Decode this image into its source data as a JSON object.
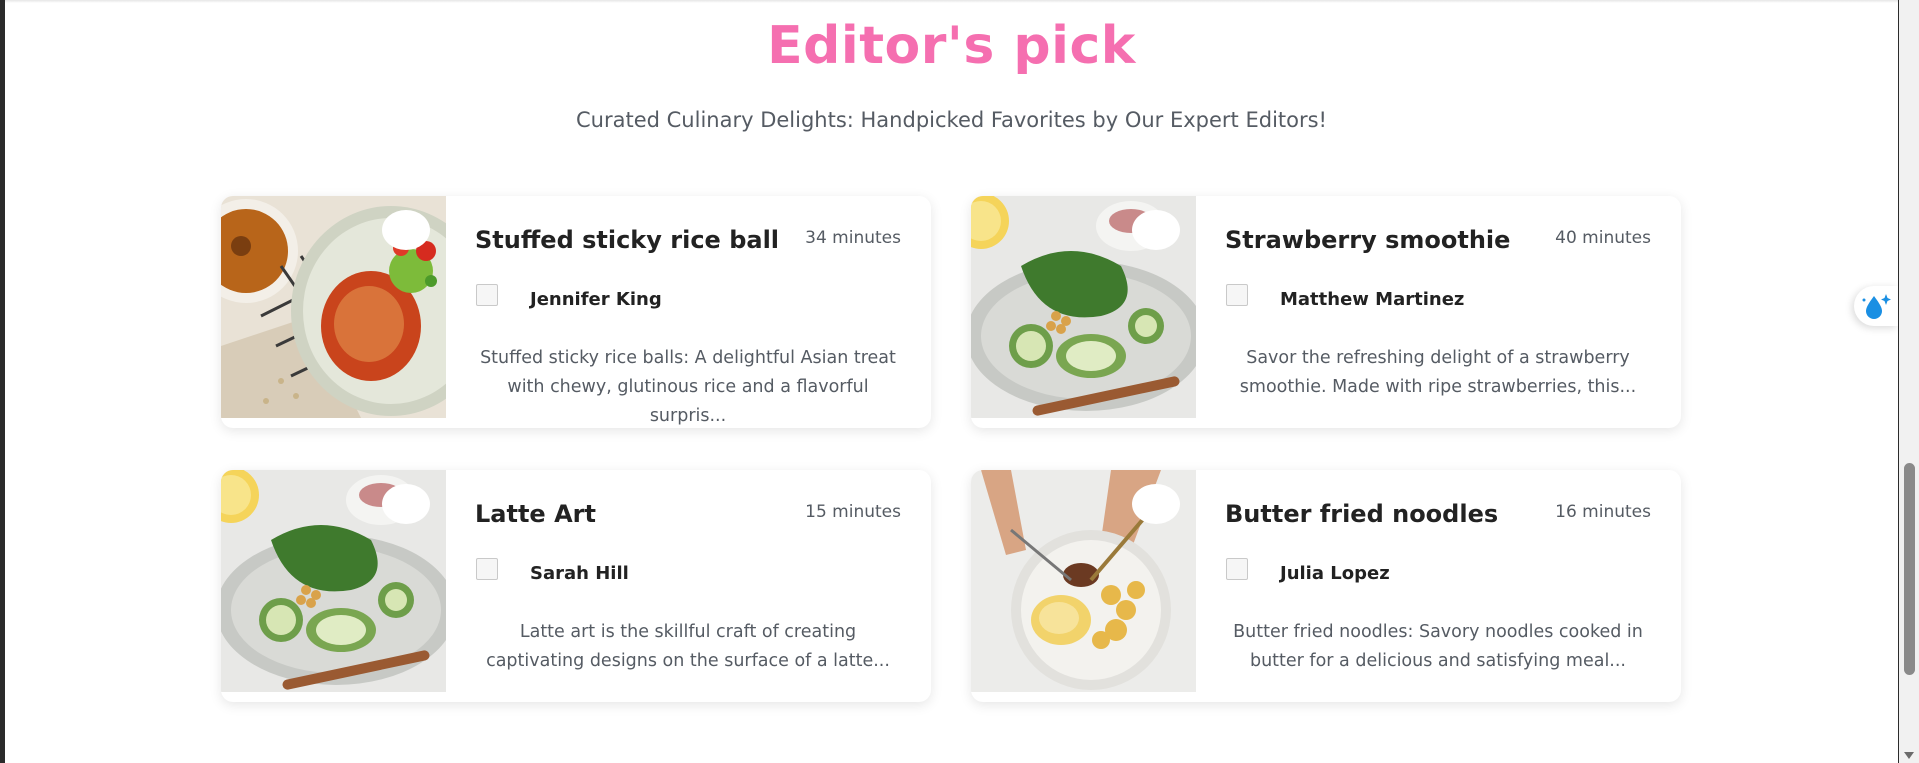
{
  "section": {
    "title": "Editor's pick",
    "subtitle": "Curated Culinary Delights: Handpicked Favorites by Our Expert Editors!"
  },
  "recipes": [
    {
      "title": "Stuffed sticky rice ball",
      "duration": "34 minutes",
      "author": "Jennifer King",
      "description": "Stuffed sticky rice balls: A delightful Asian treat with chewy, glutinous rice and a flavorful surpris...",
      "image": "food-photo-sauce-dish"
    },
    {
      "title": "Strawberry smoothie",
      "duration": "40 minutes",
      "author": "Matthew Martinez",
      "description": "Savor the refreshing delight of a strawberry smoothie. Made with ripe strawberries, this...",
      "image": "food-photo-zucchini-plate"
    },
    {
      "title": "Latte Art",
      "duration": "15 minutes",
      "author": "Sarah Hill",
      "description": "Latte art is the skillful craft of creating captivating designs on the surface of a latte...",
      "image": "food-photo-zucchini-plate"
    },
    {
      "title": "Butter fried noodles",
      "duration": "16 minutes",
      "author": "Julia Lopez",
      "description": "Butter fried noodles: Savory noodles cooked in butter for a delicious and satisfying meal...",
      "image": "food-photo-eggs-potatoes"
    }
  ],
  "colors": {
    "title_accent": "#f56fb0",
    "text_muted": "#555b63",
    "text_dark": "#222222",
    "widget_accent": "#1a8fe3"
  },
  "icons": {
    "favorite": "heart-icon",
    "floating_widget": "water-drop-sparkle-icon",
    "avatar": "broken-image-icon"
  }
}
